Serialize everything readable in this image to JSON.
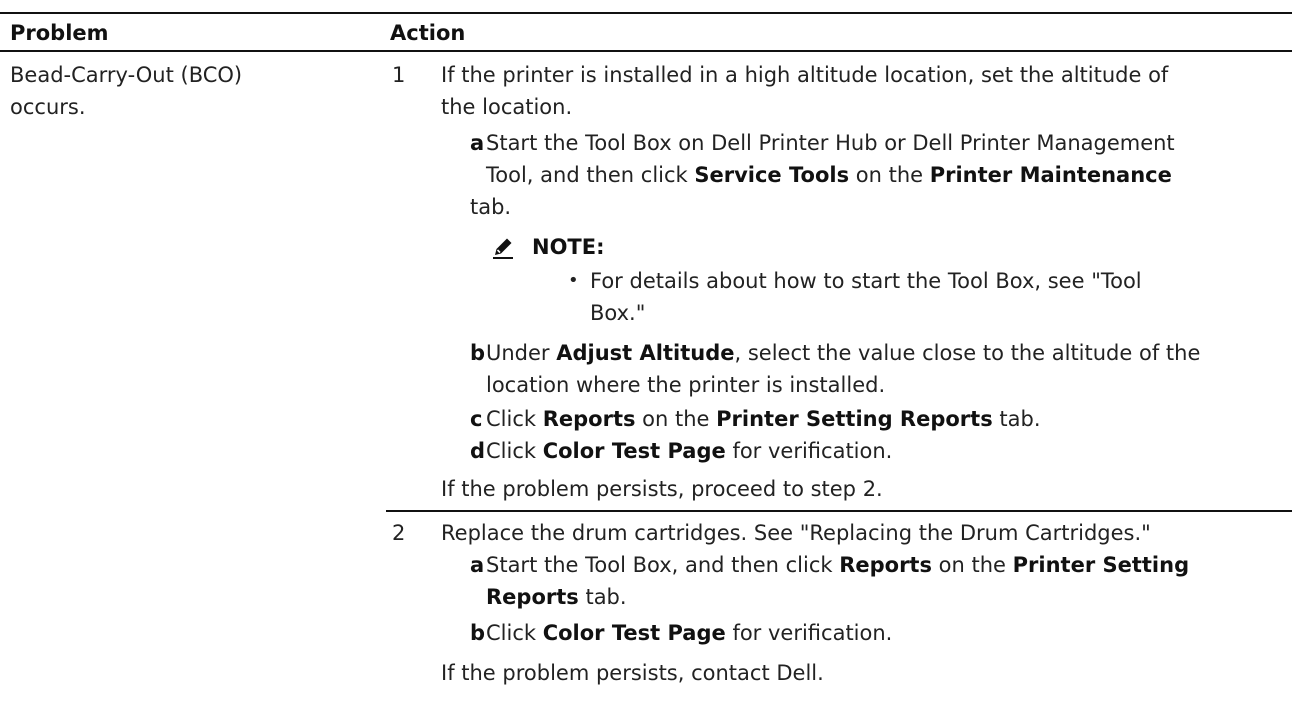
{
  "table": {
    "headers": {
      "problem": "Problem",
      "action": "Action"
    },
    "problem_lines": [
      "Bead-Carry-Out (BCO)",
      "occurs."
    ],
    "step1": {
      "number": "1",
      "intro_lines": [
        "If the printer is installed in a high altitude location, set the altitude of",
        "the location."
      ],
      "a": {
        "letter": "a",
        "line1": "Start the Tool Box on Dell Printer Hub or Dell Printer Management",
        "line2_pre": "Tool, and then click ",
        "line2_b1": "Service Tools",
        "line2_mid": " on the ",
        "line2_b2": "Printer Maintenance",
        "line3": "tab."
      },
      "note": {
        "label": "NOTE:",
        "bullet_line1": "For details about how to start the Tool Box, see \"Tool",
        "bullet_line2": "Box.\""
      },
      "b": {
        "letter": "b",
        "pre": "Under ",
        "bold": "Adjust Altitude",
        "post": ", select the value close to the altitude of the",
        "line2": "location where the printer is installed."
      },
      "c": {
        "letter": "c",
        "pre": "Click ",
        "bold1": "Reports",
        "mid": " on the ",
        "bold2": "Printer Setting Reports",
        "post": " tab."
      },
      "d": {
        "letter": "d",
        "pre": "Click ",
        "bold": "Color Test Page",
        "post": " for verification."
      },
      "footer": "If the problem persists, proceed to step 2."
    },
    "step2": {
      "number": "2",
      "intro": "Replace the drum cartridges. See \"Replacing the Drum Cartridges.\"",
      "a": {
        "letter": "a",
        "pre": "Start the Tool Box, and then click ",
        "bold1": "Reports",
        "mid": " on the ",
        "bold2": "Printer Setting",
        "line2_bold": "Reports",
        "line2_post": " tab."
      },
      "b": {
        "letter": "b",
        "pre": "Click ",
        "bold": "Color Test Page",
        "post": " for verification."
      },
      "footer": "If the problem persists, contact Dell."
    }
  }
}
